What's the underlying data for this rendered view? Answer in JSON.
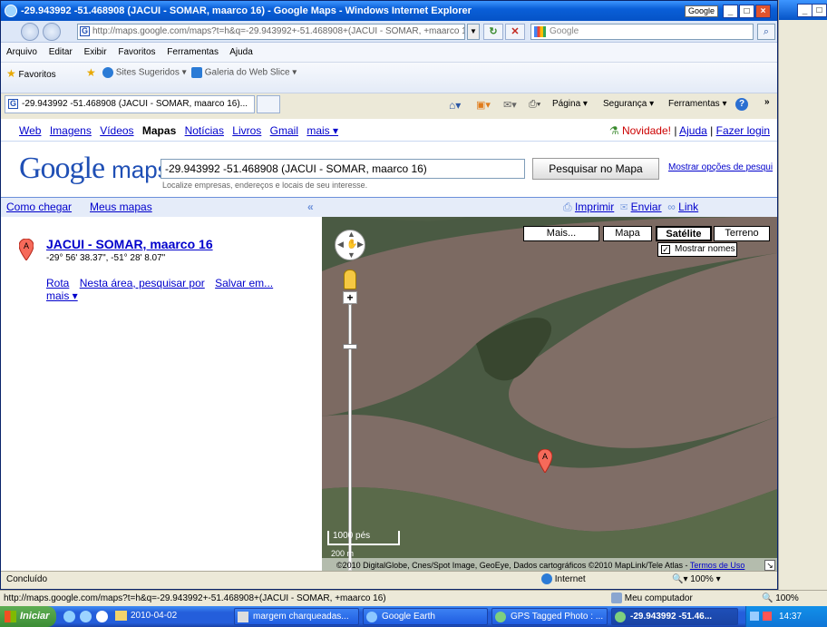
{
  "window": {
    "title": "-29.943992 -51.468908 (JACUI - SOMAR, maarco 16) - Google Maps - Windows Internet Explorer",
    "title_search_tooltip": "Google",
    "address_url": "http://maps.google.com/maps?t=h&q=-29.943992+-51.468908+(JACUI - SOMAR, +maarco 16",
    "search_engine": "Google",
    "menu": [
      "Arquivo",
      "Editar",
      "Exibir",
      "Favoritos",
      "Ferramentas",
      "Ajuda"
    ],
    "favorites_label": "Favoritos",
    "fav_links": [
      "Sites Sugeridos ▾",
      "Galeria do Web Slice ▾"
    ],
    "tab_title": "-29.943992 -51.468908 (JACUI - SOMAR, maarco 16)...",
    "command_bar": [
      "Página ▾",
      "Segurança ▾",
      "Ferramentas ▾"
    ],
    "status_text": "Concluído",
    "zone": "Internet",
    "zoom": "100%"
  },
  "gbar": {
    "links": [
      "Web",
      "Imagens",
      "Vídeos",
      "Notícias",
      "Livros",
      "Gmail",
      "mais ▾"
    ],
    "current": "Mapas",
    "novidade": "Novidade!",
    "ajuda": "Ajuda",
    "login": "Fazer login"
  },
  "search": {
    "logo_google": "Google",
    "logo_maps": "maps",
    "query": "-29.943992 -51.468908 (JACUI - SOMAR, maarco 16)",
    "hint": "Localize empresas, endereços e locais de seu interesse.",
    "button": "Pesquisar no Mapa",
    "options_link": "Mostrar opções de pesqui"
  },
  "panel": {
    "como_chegar": "Como chegar",
    "meus_mapas": "Meus mapas",
    "collapse": "«",
    "imprimir": "Imprimir",
    "enviar": "Enviar",
    "link": "Link"
  },
  "result": {
    "marker": "A",
    "title": "JACUI - SOMAR, maarco 16",
    "coords": "-29° 56' 38.37\", -51° 28' 8.07\"",
    "actions": [
      "Rota",
      "Nesta área, pesquisar por",
      "Salvar em..."
    ],
    "more": "mais ▾"
  },
  "map": {
    "types": [
      "Mais...",
      "Mapa",
      "Satélite",
      "Terreno"
    ],
    "selected_type": "Satélite",
    "show_names": "Mostrar nomes",
    "scale_label": "1000 pés",
    "scale_label_small": "200 m",
    "marker": "A",
    "attribution": "©2010 DigitalGlobe, Cnes/Spot Image, GeoEye, Dados cartográficos ©2010 MapLink/Tele Atlas - ",
    "terms": "Termos de Uso"
  },
  "outer": {
    "status_url": "http://maps.google.com/maps?t=h&q=-29.943992+-51.468908+(JACUI - SOMAR, +maarco 16)",
    "zone": "Meu computador",
    "zoom": "100%"
  },
  "taskbar": {
    "start": "Iniciar",
    "folder": "2010-04-02",
    "tasks": [
      "margem charqueadas...",
      "Google Earth",
      "GPS Tagged Photo : ...",
      "-29.943992 -51.46..."
    ],
    "clock": "14:37"
  }
}
